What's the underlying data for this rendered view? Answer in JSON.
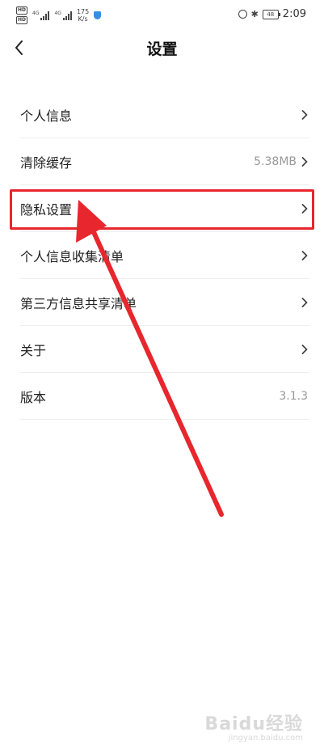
{
  "status_bar": {
    "hd_1": "HD",
    "hd_2": "HD",
    "net_1": "4G",
    "net_2": "4G",
    "speed_value": "175",
    "speed_unit": "K/s",
    "battery": "48",
    "time": "2:09"
  },
  "header": {
    "title": "设置"
  },
  "settings": {
    "items": [
      {
        "label": "个人信息",
        "value": ""
      },
      {
        "label": "清除缓存",
        "value": "5.38MB"
      },
      {
        "label": "隐私设置",
        "value": ""
      },
      {
        "label": "个人信息收集清单",
        "value": ""
      },
      {
        "label": "第三方信息共享清单",
        "value": ""
      },
      {
        "label": "关于",
        "value": ""
      },
      {
        "label": "版本",
        "value": "3.1.3"
      }
    ]
  },
  "annotation": {
    "color": "#e8262d",
    "highlighted_item": "隐私设置"
  },
  "watermark": {
    "logo": "Baidu经验",
    "url": "jingyan.baidu.com"
  }
}
